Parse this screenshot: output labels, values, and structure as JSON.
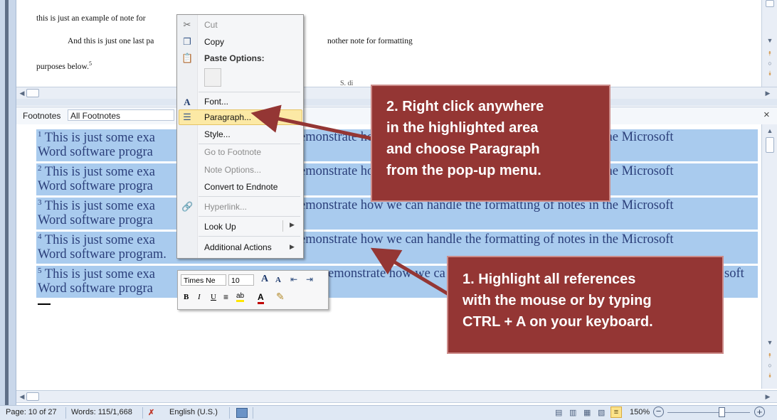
{
  "document": {
    "lines": [
      "this is just an example of note for",
      "And this is just one last pa",
      "nother note for formatting",
      "purposes below.",
      "5"
    ],
    "footnote_text": "This is just some exa",
    "footnote_mid": "emonstrate how we can handle the formatting of notes in the Microsoft",
    "footnote_mid_partial": "emonstrate how we ca",
    "footnote_end_short": "soft",
    "footnote_second_line": "Word software progra",
    "footnote_second_line_full": "Word software program.",
    "footnote_numbers": [
      "1",
      "2",
      "3",
      "4",
      "5"
    ],
    "partial_word": "S. di"
  },
  "footnotes_pane": {
    "label": "Footnotes",
    "selector_value": "All Footnotes",
    "close_glyph": "×"
  },
  "context_menu": {
    "items": [
      {
        "label": "Cut",
        "icon": "scissors-icon",
        "disabled": true
      },
      {
        "label": "Copy",
        "icon": "copy-icon",
        "disabled": false
      },
      {
        "label": "Paste Options:",
        "icon": "paste-icon",
        "disabled": false
      },
      {
        "label": "Font...",
        "icon": "font-icon",
        "disabled": false
      },
      {
        "label": "Paragraph...",
        "icon": "paragraph-icon",
        "disabled": false,
        "highlighted": true
      },
      {
        "label": "Style...",
        "icon": "",
        "disabled": false
      },
      {
        "label": "Go to Footnote",
        "icon": "",
        "disabled": true
      },
      {
        "label": "Note Options...",
        "icon": "",
        "disabled": true
      },
      {
        "label": "Convert to Endnote",
        "icon": "",
        "disabled": false
      },
      {
        "label": "Hyperlink...",
        "icon": "hyperlink-icon",
        "disabled": true
      },
      {
        "label": "Look Up",
        "icon": "",
        "disabled": false
      },
      {
        "label": "Additional Actions",
        "icon": "",
        "disabled": false
      }
    ]
  },
  "mini_toolbar": {
    "font_name": "Times Ne",
    "font_size": "10",
    "grow_font": "A",
    "shrink_font": "A",
    "bold": "B",
    "italic": "I",
    "underline": "U",
    "font_color": "A",
    "highlight": "ab"
  },
  "callouts": {
    "step2": [
      "2. Right click anywhere",
      "in the highlighted area",
      "and choose Paragraph",
      "from the pop-up menu."
    ],
    "step1": [
      "1. Highlight all references",
      "with the mouse or by typing",
      "CTRL + A on your keyboard."
    ]
  },
  "status_bar": {
    "page": "Page: 10 of 27",
    "words": "Words: 115/1,668",
    "language": "English (U.S.)",
    "zoom": "150%"
  },
  "colors": {
    "callout_bg": "#943634",
    "selection": "#a9cbee",
    "arrow": "#943634"
  }
}
